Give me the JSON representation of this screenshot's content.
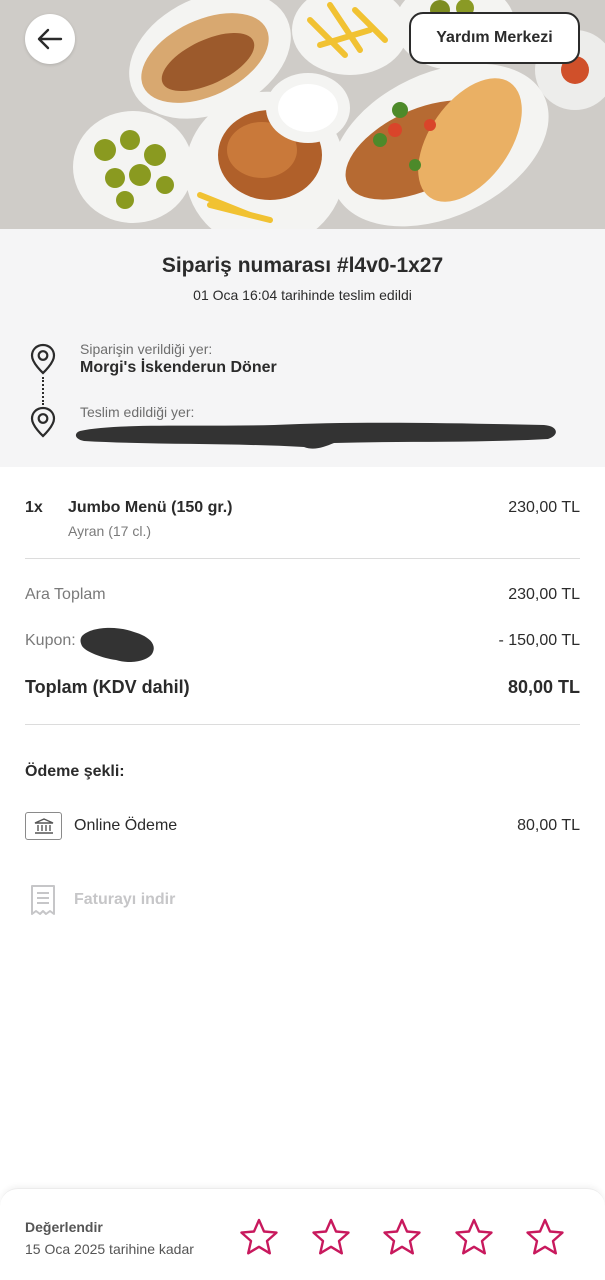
{
  "header": {
    "back_icon": "arrow-left-icon",
    "help_label": "Yardım Merkezi"
  },
  "order": {
    "title": "Sipariş numarası #l4v0-1x27",
    "delivered_text": "01 Oca 16:04 tarihinde teslim edildi"
  },
  "addresses": {
    "from_label": "Siparişin verildiği yer:",
    "from_name": "Morgi's İskenderun Döner",
    "to_label": "Teslim edildiği yer:",
    "pin_icon": "location-pin-icon"
  },
  "items": [
    {
      "qty": "1x",
      "name": "Jumbo Menü (150 gr.)",
      "detail": "Ayran (17 cl.)",
      "price": "230,00 TL"
    }
  ],
  "summary": {
    "subtotal_label": "Ara Toplam",
    "subtotal_value": "230,00 TL",
    "coupon_label": "Kupon:",
    "coupon_value": "- 150,00 TL",
    "total_label": "Toplam (KDV dahil)",
    "total_value": "80,00 TL"
  },
  "payment": {
    "title": "Ödeme şekli:",
    "method": "Online Ödeme",
    "amount": "80,00 TL",
    "icon": "bank-card-icon"
  },
  "invoice": {
    "label": "Faturayı indir",
    "icon": "receipt-icon"
  },
  "rating": {
    "title": "Değerlendir",
    "deadline": "15 Oca 2025 tarihine kadar",
    "stars": 5,
    "star_color": "#c8195d"
  },
  "colors": {
    "accent": "#c8195d",
    "header_bg": "#f5f5f6",
    "muted_text": "#7a7a7a",
    "disabled_text": "#c6c6c8"
  }
}
